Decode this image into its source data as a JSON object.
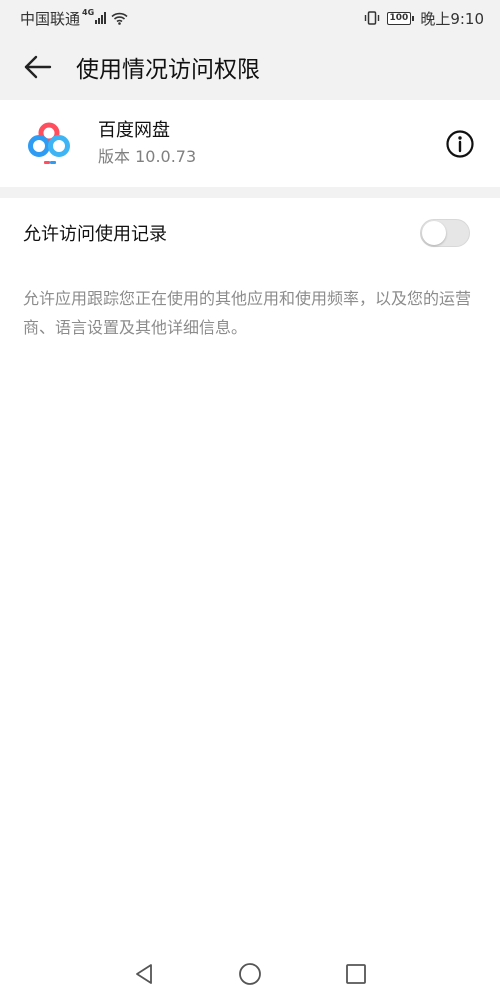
{
  "status_bar": {
    "carrier": "中国联通",
    "network_badge": "4G",
    "battery_level": "100",
    "time": "晚上9:10",
    "icons": [
      "signal-icon",
      "wifi-icon",
      "vibrate-icon",
      "battery-icon"
    ]
  },
  "header": {
    "title": "使用情况访问权限",
    "back_icon": "arrow-left-icon"
  },
  "app": {
    "name": "百度网盘",
    "version": "版本 10.0.73",
    "icon": "baidu-netdisk-icon",
    "info_icon": "info-icon"
  },
  "permission": {
    "label": "允许访问使用记录",
    "enabled": false,
    "description": "允许应用跟踪您正在使用的其他应用和使用频率，以及您的运营商、语言设置及其他详细信息。"
  },
  "nav": {
    "icons": [
      "back-triangle-icon",
      "home-circle-icon",
      "recents-square-icon"
    ]
  },
  "colors": {
    "background": "#f2f2f2",
    "card": "#ffffff",
    "secondary_text": "#808080",
    "toggle_off": "#e6e6e6",
    "app_icon_blue": "#2f9cf4",
    "app_icon_red": "#ff4f5e"
  }
}
